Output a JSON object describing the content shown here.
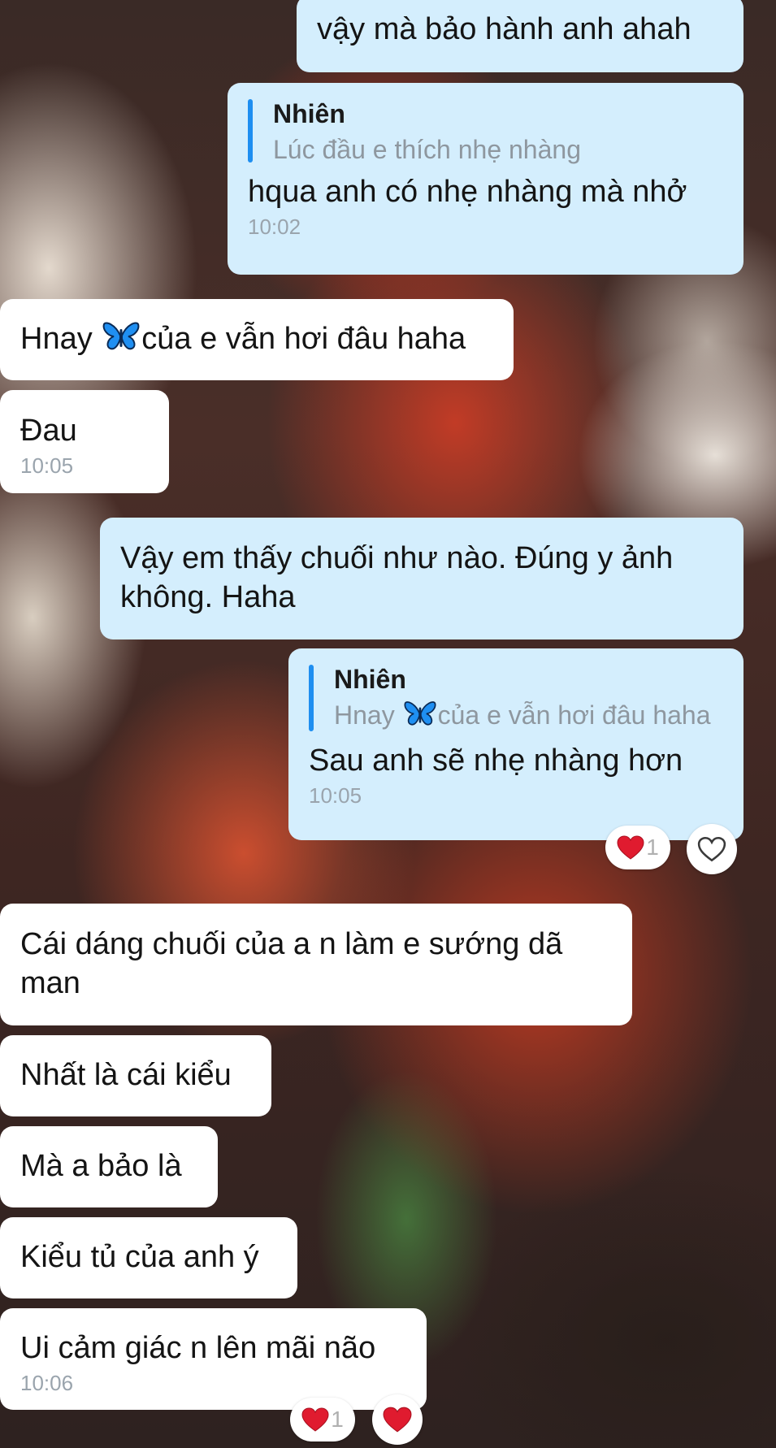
{
  "messages": [
    {
      "side": "out",
      "text": "vậy mà bảo hành anh ahah"
    },
    {
      "side": "out",
      "quote_name": "Nhiên",
      "quote_text": "Lúc đầu e thích nhẹ nhàng",
      "text": "hqua anh có nhẹ nhàng mà nhở",
      "time": "10:02"
    },
    {
      "side": "in",
      "text_before": "Hnay",
      "emoji": "butterfly-icon",
      "text_after": "của e vẫn hơi đâu haha"
    },
    {
      "side": "in",
      "text": "Đau",
      "time": "10:05"
    },
    {
      "side": "out",
      "text": "Vậy em thấy chuối như nào. Đúng y ảnh không. Haha"
    },
    {
      "side": "out",
      "quote_name": "Nhiên",
      "quote_before": "Hnay",
      "quote_emoji": "butterfly-icon",
      "quote_after": "của e vẫn hơi đâu haha",
      "text": "Sau anh sẽ nhẹ nhàng hơn",
      "time": "10:05",
      "reaction_icon": "heart-icon",
      "reaction_count": "1"
    },
    {
      "side": "in",
      "text": "Cái dáng chuối của a n làm e sướng dã man"
    },
    {
      "side": "in",
      "text": "Nhất là cái kiểu"
    },
    {
      "side": "in",
      "text": "Mà a bảo là"
    },
    {
      "side": "in",
      "text": "Kiểu tủ của anh ý"
    },
    {
      "side": "in",
      "text": "Ui cảm giác n lên mãi não",
      "time": "10:06",
      "reaction_icon": "heart-icon",
      "reaction_count": "1"
    }
  ],
  "colors": {
    "outgoing_bubble": "#d4eefd",
    "incoming_bubble": "#ffffff",
    "quote_bar": "#1e8ef0",
    "heart": "#e01b2f",
    "timestamp": "#9aa4ad"
  }
}
